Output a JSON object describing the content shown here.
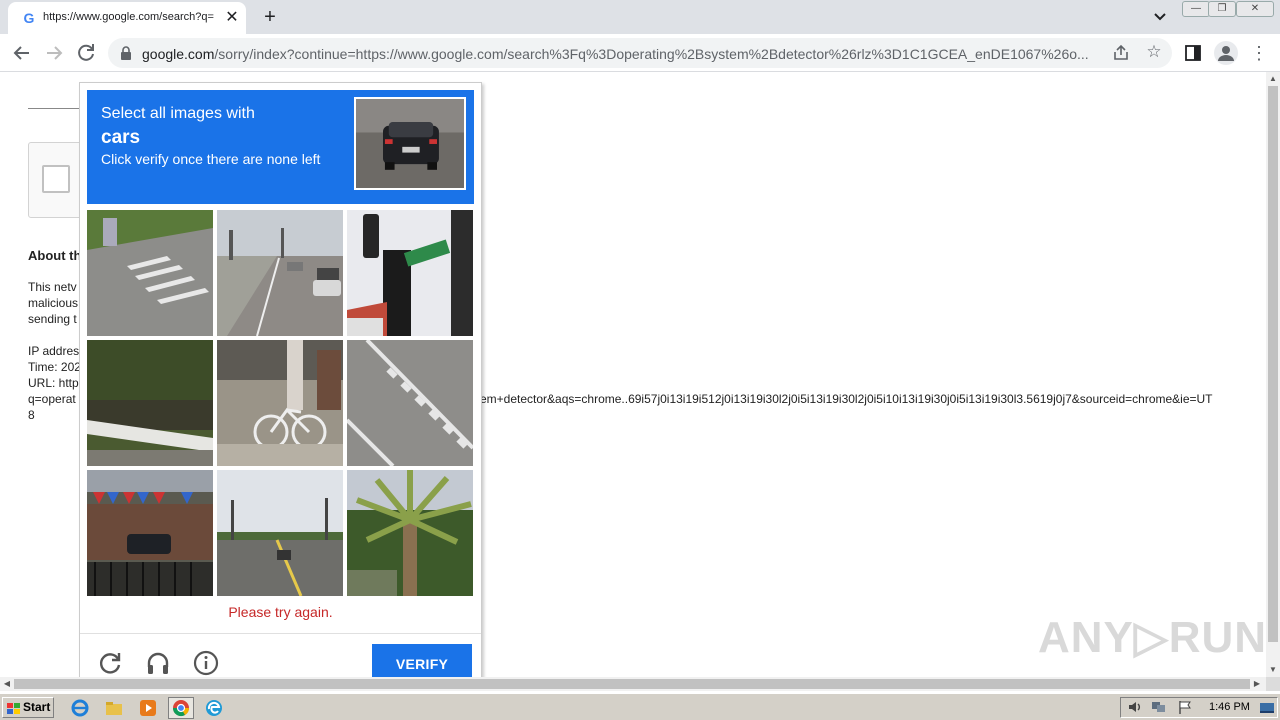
{
  "browser": {
    "tab_title": "https://www.google.com/search?q=",
    "tab_favicon": "G",
    "tab_close": "✕",
    "new_tab": "+",
    "url_host": "google.com",
    "url_rest": "/sorry/index?continue=https://www.google.com/search%3Fq%3Doperating%2Bsystem%2Bdetector%26rlz%3D1C1GCEA_enDE1067%26o...",
    "window_controls": {
      "minimize": "—",
      "maximize": "❐",
      "close": "✕"
    }
  },
  "page": {
    "about_heading": "About th",
    "para_lines": [
      "This netv",
      "malicious",
      "sending t"
    ],
    "ip_label": "IP addres",
    "time_label": "Time: 202",
    "url_label": "URL: http",
    "url_line_start": "q=operat",
    "url_line_end": "em+detector&aqs=chrome..69i57j0i13i19i512j0i13i19i30l2j0i5i13i19i30l2j0i5i10i13i19i30j0i5i13i19i30l3.5619j0j7&sourceid=chrome&ie=UT",
    "url_line_wrap": "8"
  },
  "captcha": {
    "prompt_line1": "Select all images with",
    "prompt_keyword": "cars",
    "prompt_line2": "Click verify once there are none left",
    "error": "Please try again.",
    "verify_label": "VERIFY",
    "tiles": [
      {
        "name": "tile-crosswalk-grass"
      },
      {
        "name": "tile-road-with-cars"
      },
      {
        "name": "tile-traffic-light-sign"
      },
      {
        "name": "tile-railing-trees"
      },
      {
        "name": "tile-bicycle"
      },
      {
        "name": "tile-crosswalk-stripes"
      },
      {
        "name": "tile-storefront-car"
      },
      {
        "name": "tile-street-road"
      },
      {
        "name": "tile-palm-tree"
      }
    ],
    "icons": [
      "reload-icon",
      "headphones-icon",
      "info-icon"
    ]
  },
  "watermark": "ANY▷RUN",
  "taskbar": {
    "start_label": "Start",
    "clock": "1:46 PM"
  },
  "colors": {
    "captcha_blue": "#1a73e8",
    "error_red": "#c62828",
    "chrome_bg": "#dee1e6"
  }
}
